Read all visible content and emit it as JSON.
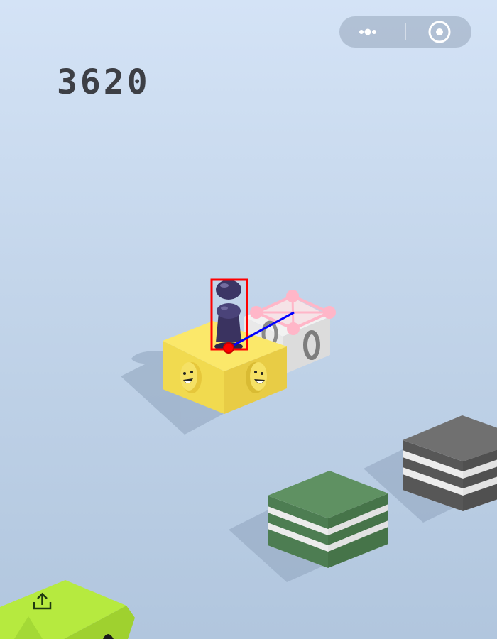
{
  "hud": {
    "score": "3620",
    "capsule_menu_icon": "more-dots-icon",
    "capsule_close_icon": "target-circle-icon"
  },
  "scene": {
    "current_block": "yellow-smiley-box",
    "next_block": "white-zero-box",
    "blocks": [
      "green-striped-box",
      "gray-striped-box",
      "lime-share-box"
    ],
    "share_icon": "share-upload-icon"
  },
  "overlay": {
    "detection_box_color": "#ff0000",
    "aim_line_color": "#0000ff",
    "target_marker_color": "#ffb6c8"
  },
  "colors": {
    "yellow_top": "#fbe86a",
    "green_top": "#5f9162",
    "gray_top": "#707070",
    "lime_top": "#b6ea3f"
  }
}
